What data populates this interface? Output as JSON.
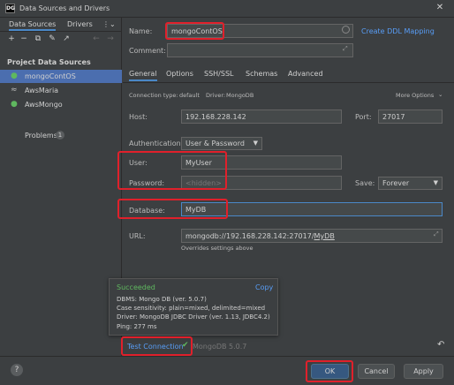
{
  "window": {
    "title": "Data Sources and Drivers",
    "app_icon": "DG"
  },
  "left": {
    "tabs": [
      "Data Sources",
      "Drivers"
    ],
    "section_title": "Project Data Sources",
    "items": [
      {
        "label": "mongoContOS",
        "icon": "mongodb-leaf-icon"
      },
      {
        "label": "AwsMaria",
        "icon": "mariadb-seal-icon"
      },
      {
        "label": "AwsMongo",
        "icon": "mongodb-leaf-icon"
      }
    ],
    "problems_label": "Problems",
    "problems_count": "1"
  },
  "form": {
    "name_label": "Name:",
    "name_value": "mongoContOS",
    "create_ddl": "Create DDL Mapping",
    "comment_label": "Comment:",
    "tabs": [
      "General",
      "Options",
      "SSH/SSL",
      "Schemas",
      "Advanced"
    ],
    "conn_type_label": "Connection type:",
    "conn_type_value": "default",
    "driver_label": "Driver:",
    "driver_value": "MongoDB",
    "more_options": "More Options",
    "host_label": "Host:",
    "host_value": "192.168.228.142",
    "port_label": "Port:",
    "port_value": "27017",
    "auth_label": "Authentication:",
    "auth_value": "User & Password",
    "user_label": "User:",
    "user_value": "MyUser",
    "password_label": "Password:",
    "password_value": "<hidden>",
    "save_label": "Save:",
    "save_value": "Forever",
    "database_label": "Database:",
    "database_value": "MyDB",
    "url_label": "URL:",
    "url_prefix": "mongodb://192.168.228.142:27017/",
    "url_db": "MyDB",
    "url_note": "Overrides settings above"
  },
  "popup": {
    "status": "Succeeded",
    "copy": "Copy",
    "lines": [
      "DBMS: Mongo DB (ver. 5.0.7)",
      "Case sensitivity: plain=mixed, delimited=mixed",
      "Driver: MongoDB JDBC Driver (ver. 1.13, JDBC4.2)",
      "Ping: 277 ms"
    ]
  },
  "footer": {
    "test_connection": "Test Connection",
    "test_version": "MongoDB 5.0.7",
    "help": "?",
    "ok": "OK",
    "cancel": "Cancel",
    "apply": "Apply"
  },
  "colors": {
    "accent": "#4a88c7",
    "link": "#589df6",
    "success": "#5fb85f",
    "highlight_box": "#e0202b",
    "selected": "#4b6eaf"
  }
}
